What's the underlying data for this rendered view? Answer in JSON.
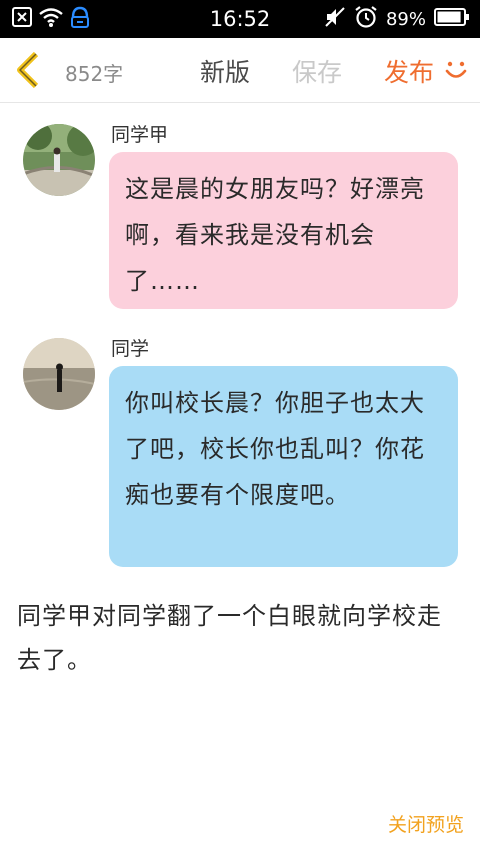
{
  "status_bar": {
    "time": "16:52",
    "battery_percent": "89%",
    "battery_level": 0.89,
    "icons": [
      "close-box-icon",
      "wifi-icon",
      "upload-icon",
      "mute-icon",
      "alarm-icon",
      "battery-icon"
    ]
  },
  "toolbar": {
    "word_count": "852字",
    "new_version": "新版",
    "save": "保存",
    "publish": "发布",
    "colors": {
      "publish": "#ef6d2f",
      "save_disabled": "#c9c9c9",
      "back": "#f0c21b"
    }
  },
  "messages": [
    {
      "sender": "同学甲",
      "text": "这是晨的女朋友吗？好漂亮啊，看来我是没有机会了……",
      "bubble_color": "#fcd0dc"
    },
    {
      "sender": "同学",
      "text": "你叫校长晨？你胆子也太大了吧，校长你也乱叫？你花痴也要有个限度吧。",
      "bubble_color": "#a9dcf6"
    }
  ],
  "narration": "同学甲对同学翻了一个白眼就向学校走去了。",
  "footer": {
    "close_preview": "关闭预览",
    "color": "#f2a21f"
  }
}
